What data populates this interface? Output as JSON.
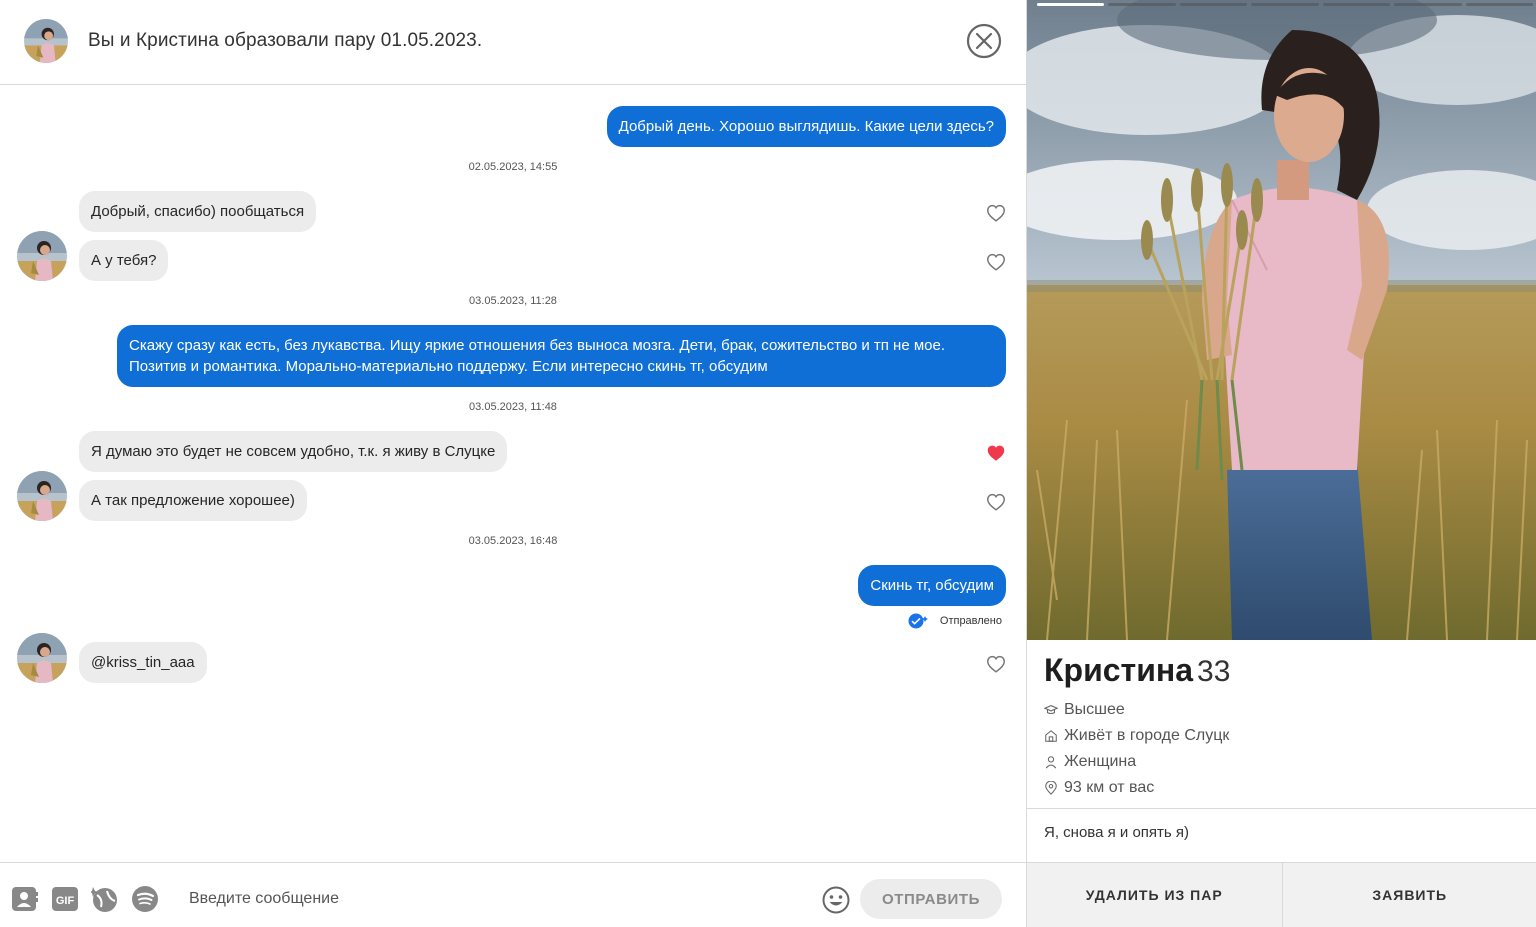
{
  "header": {
    "title": "Вы и Кристина образовали пару 01.05.2023."
  },
  "messages": {
    "m1": "Добрый день. Хорошо выглядишь. Какие цели здесь?",
    "ts1": "02.05.2023, 14:55",
    "m2": "Добрый, спасибо) пообщаться",
    "m3": "А у тебя?",
    "ts2": "03.05.2023, 11:28",
    "m4": "Скажу сразу как есть, без лукавства. Ищу яркие отношения без выноса мозга. Дети, брак, сожительство и тп не мое. Позитив и романтика. Морально-материально поддержу. Если интересно скинь тг, обсудим",
    "ts3": "03.05.2023, 11:48",
    "m5": "Я думаю это будет не совсем удобно, т.к. я живу в Слуцке",
    "m6": "А так предложение хорошее)",
    "ts4": "03.05.2023, 16:48",
    "m7": "Скинь тг, обсудим",
    "status": "Отправлено",
    "m8": "@kriss_tin_aaa"
  },
  "composer": {
    "placeholder": "Введите сообщение",
    "gif_label": "GIF",
    "send_label": "ОТПРАВИТЬ"
  },
  "profile": {
    "name": "Кристина",
    "age": "33",
    "education": "Высшее",
    "city": "Живёт в городе Слуцк",
    "gender": "Женщина",
    "distance": "93 км от вас",
    "bio": "Я, снова я и опять я)",
    "photo_index": 1,
    "photo_count": 7,
    "remove_label": "УДАЛИТЬ ИЗ ПАР",
    "report_label": "ЗАЯВИТЬ"
  },
  "colors": {
    "outgoing_bubble": "#0f6fd6",
    "incoming_bubble": "#ececec",
    "heart_active": "#f0394a"
  }
}
